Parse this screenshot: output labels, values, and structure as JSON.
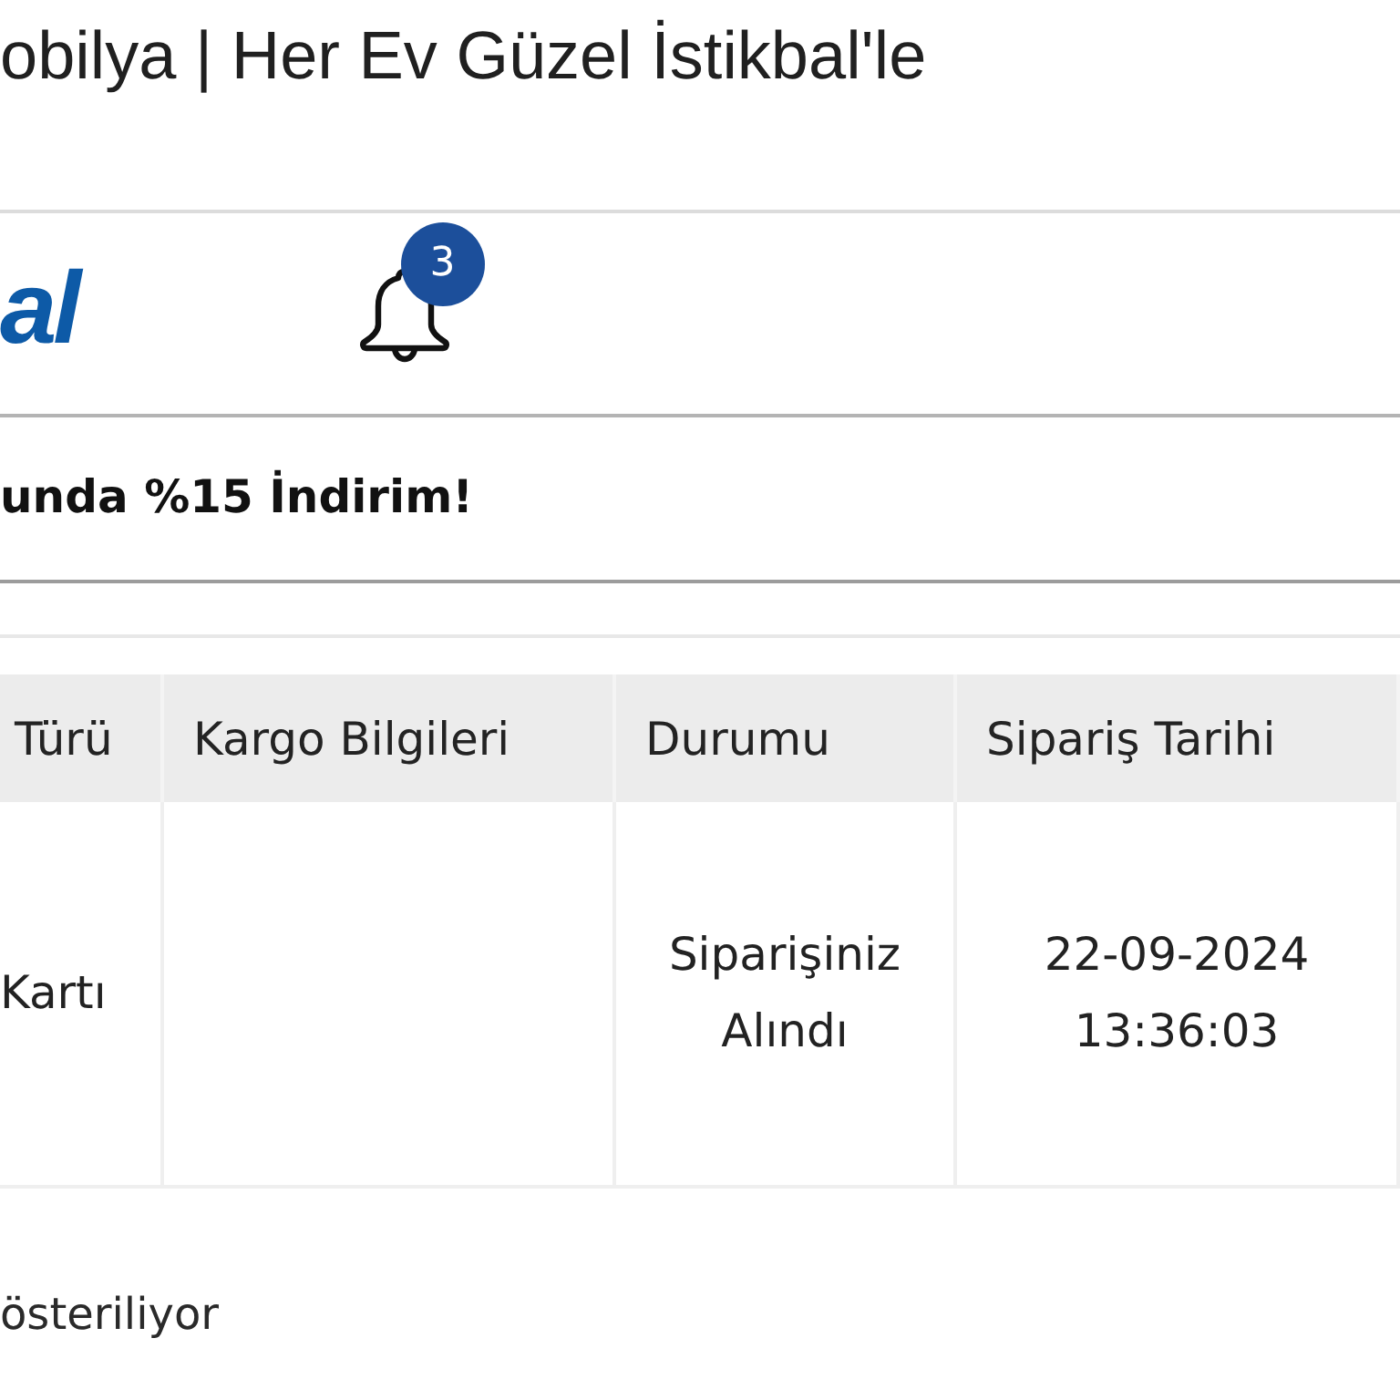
{
  "page_title": "obilya | Her Ev Güzel İstikbal'le",
  "header": {
    "logo_text": "al",
    "notifications": {
      "count": "3"
    }
  },
  "promo": {
    "text": "unda %15 İndirim!"
  },
  "orders_table": {
    "columns": [
      "Türü",
      "Kargo Bilgileri",
      "Durumu",
      "Sipariş Tarihi"
    ],
    "rows": [
      {
        "column_1": "Kartı",
        "status": "Siparişiniz Alındı",
        "order_date": "22-09-2024 13:36:03"
      }
    ]
  },
  "footer": {
    "text": "österiliyor"
  }
}
